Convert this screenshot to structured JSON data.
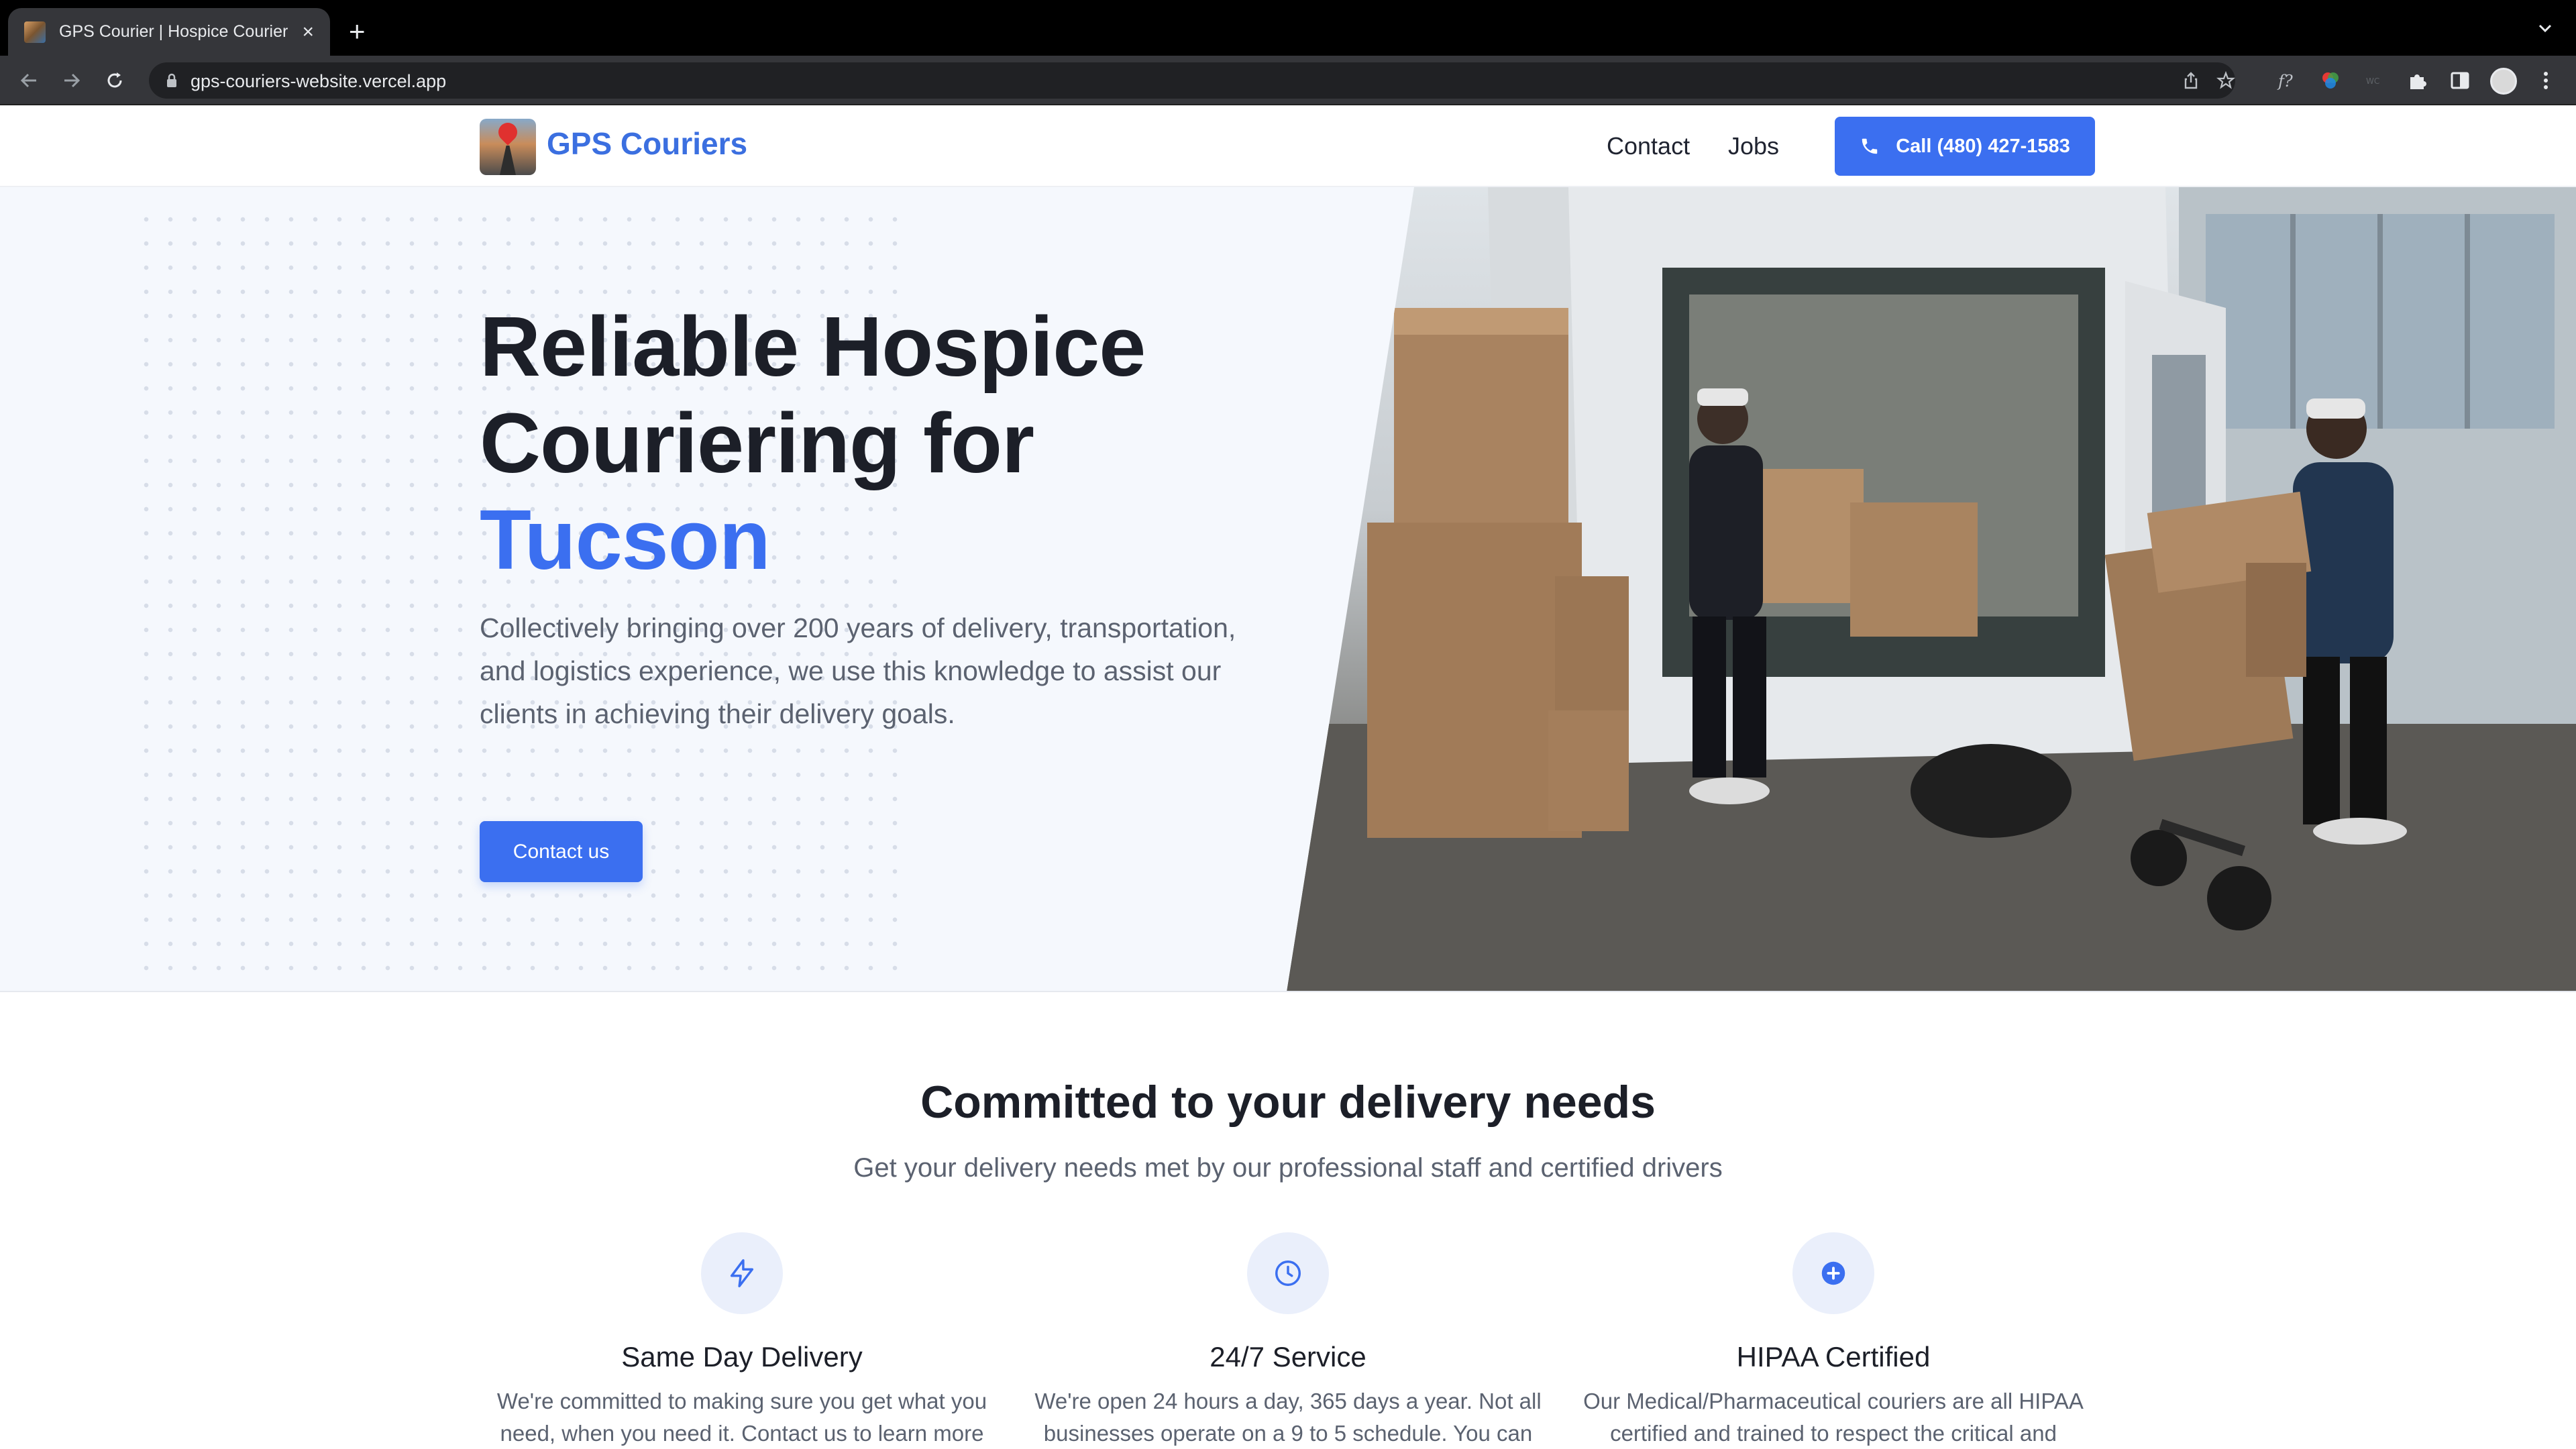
{
  "browser": {
    "tab_title": "GPS Courier | Hospice Courier",
    "new_tab": "+",
    "close": "×",
    "url": "gps-couriers-website.vercel.app"
  },
  "header": {
    "logo_text": "GPS Couriers",
    "nav": [
      {
        "label": "Contact"
      },
      {
        "label": "Jobs"
      }
    ],
    "call_label": "Call (480) 427-1583"
  },
  "hero": {
    "title_line1": "Reliable Hospice",
    "title_line2": "Couriering for",
    "title_accent": "Tucson",
    "subtitle": "Collectively bringing over 200 years of delivery, transportation, and logistics experience, we use this knowledge to assist our clients in achieving their delivery goals.",
    "cta_label": "Contact us"
  },
  "features": {
    "title": "Committed to your delivery needs",
    "subtitle": "Get your delivery needs met by our professional staff and certified drivers",
    "items": [
      {
        "name": "Same Day Delivery",
        "icon": "lightning-icon",
        "desc": "We're committed to making sure you get what you need, when you need it. Contact us to learn more"
      },
      {
        "name": "24/7 Service",
        "icon": "clock-icon",
        "desc": "We're open 24 hours a day, 365 days a year. Not all businesses operate on a 9 to 5 schedule. You can"
      },
      {
        "name": "HIPAA Certified",
        "icon": "plus-circle-icon",
        "desc": "Our Medical/Pharmaceutical couriers are all HIPAA certified and trained to respect the critical and"
      }
    ]
  },
  "colors": {
    "accent": "#3b6ff0",
    "heading": "#1c1f28",
    "body_text": "#5b6270",
    "hero_bg": "#f5f8fd"
  }
}
